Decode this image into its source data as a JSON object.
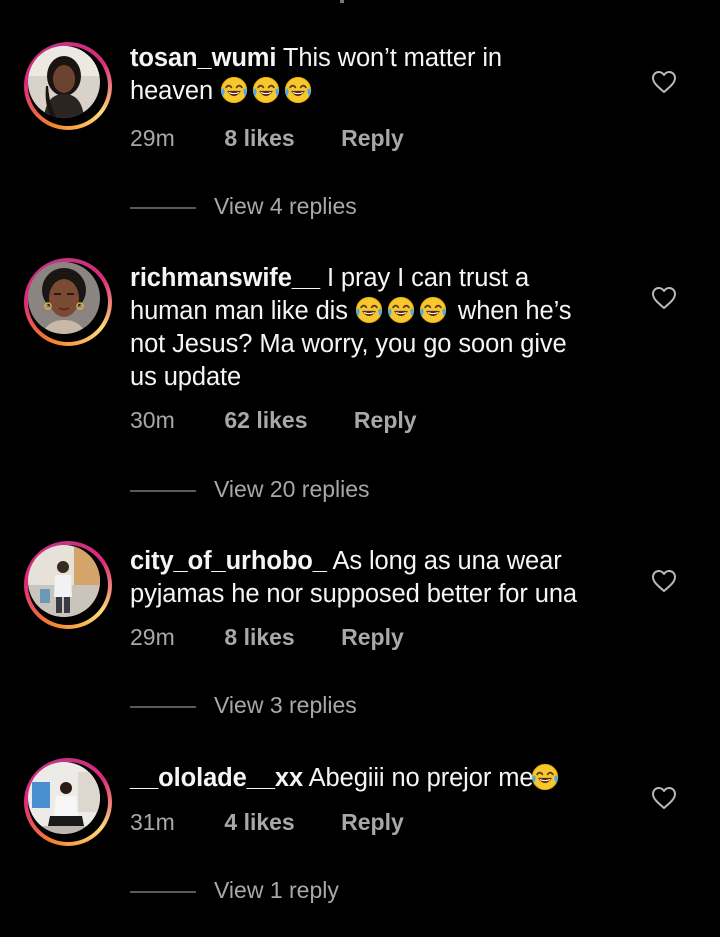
{
  "comments": [
    {
      "username": "tosan_wumi",
      "text_lines": [
        "This won’t matter in",
        "heaven"
      ],
      "trailing_emoji": 3,
      "time": "29m",
      "likes": "8 likes",
      "reply": "Reply",
      "view_replies": "View 4 replies"
    },
    {
      "username": "richmanswife__",
      "line1": "I pray I can trust a",
      "line2_pre": "human man like dis",
      "line2_post": "when he’s",
      "line3": "not Jesus? Ma worry, you go soon give",
      "line4": "us update",
      "time": "30m",
      "likes": "62 likes",
      "reply": "Reply",
      "view_replies": "View 20 replies"
    },
    {
      "username": "city_of_urhobo_",
      "line1": "As long as una wear",
      "line2": "pyjamas he nor supposed better for una",
      "time": "29m",
      "likes": "8 likes",
      "reply": "Reply",
      "view_replies": "View 3 replies"
    },
    {
      "username": "__ololade__xx",
      "line1": "Abegiii no prejor me",
      "time": "31m",
      "likes": "4 likes",
      "reply": "Reply",
      "view_replies": "View 1 reply"
    }
  ],
  "icons": {
    "like": "heart-outline-icon",
    "emoji": "face-with-tears-of-joy-emoji"
  },
  "colors": {
    "background": "#000000",
    "text": "#f5f5f5",
    "secondary_text": "#a8a8a8",
    "ring_gradient": [
      "#f58529",
      "#dd2a7b",
      "#feda77"
    ]
  }
}
